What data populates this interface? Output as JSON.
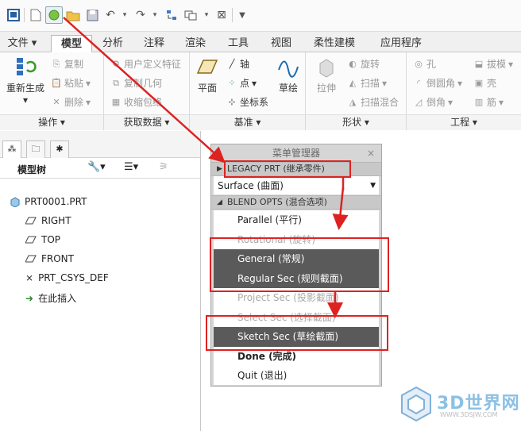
{
  "quick_access": {
    "icons": [
      "window-icon",
      "new-file-icon",
      "open-session-icon",
      "open-folder-icon",
      "save-icon",
      "undo-icon",
      "redo-icon",
      "regenerate-icon",
      "switch-window-icon",
      "close-window-icon",
      "customize-icon"
    ]
  },
  "tabs": [
    "文件",
    "模型",
    "分析",
    "注释",
    "渲染",
    "工具",
    "视图",
    "柔性建模",
    "应用程序"
  ],
  "active_tab": "模型",
  "ribbon": {
    "operations": {
      "regenerate": "重新生成",
      "copy": "复制",
      "paste": "粘贴",
      "delete": "删除",
      "footer": "操作"
    },
    "get_data": {
      "udf": "用户定义特征",
      "copy_geom": "复制几何",
      "shrinkwrap": "收缩包络",
      "footer": "获取数据"
    },
    "datum": {
      "plane": "平面",
      "axis": "轴",
      "point": "点",
      "csys": "坐标系",
      "sketch": "草绘",
      "footer": "基准"
    },
    "shapes": {
      "extrude": "拉伸",
      "revolve": "旋转",
      "sweep": "扫描",
      "swept_blend": "扫描混合",
      "footer": "形状"
    },
    "engineering": {
      "hole": "孔",
      "round": "倒圆角",
      "chamfer": "倒角",
      "draft": "拔模",
      "shell": "壳",
      "rib": "筋",
      "footer": "工程"
    }
  },
  "model_tree": {
    "title": "模型树",
    "items": [
      {
        "label": "PRT0001.PRT",
        "icon": "part-icon"
      },
      {
        "label": "RIGHT",
        "icon": "datum-plane-icon"
      },
      {
        "label": "TOP",
        "icon": "datum-plane-icon"
      },
      {
        "label": "FRONT",
        "icon": "datum-plane-icon"
      },
      {
        "label": "PRT_CSYS_DEF",
        "icon": "csys-icon"
      },
      {
        "label": "在此插入",
        "icon": "insert-here-arrow-icon"
      }
    ]
  },
  "menu_manager": {
    "title": "菜单管理器",
    "close": "×",
    "legacy": "LEGACY PRT (继承零件)",
    "dropdown": "Surface (曲面)",
    "blend": "BLEND OPTS (混合选项)",
    "items": [
      {
        "label": "Parallel (平行)",
        "state": "normal"
      },
      {
        "label": "Rotational (旋转)",
        "state": "disabled"
      },
      {
        "label": "General (常规)",
        "state": "selected"
      },
      {
        "label": "Regular Sec (规则截面)",
        "state": "selected"
      },
      {
        "label": "Project Sec (投影截面)",
        "state": "disabled"
      },
      {
        "label": "Select Sec (选择截面)",
        "state": "disabled"
      },
      {
        "label": "Sketch Sec (草绘截面)",
        "state": "selected"
      },
      {
        "label": "Done (完成)",
        "state": "bold"
      },
      {
        "label": "Quit (退出)",
        "state": "normal"
      }
    ]
  },
  "watermark": {
    "brand": "3D世界网",
    "url": "WWW.3DSJW.COM"
  },
  "colors": {
    "annotation": "#d22222",
    "selected_item": "#5a5a5a",
    "menu_bg": "#d6d6d6"
  }
}
